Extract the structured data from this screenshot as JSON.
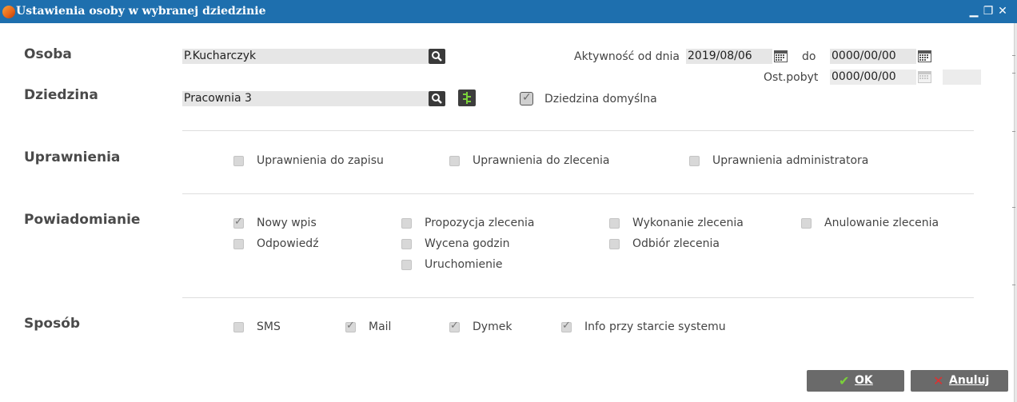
{
  "window": {
    "title": "Ustawienia osoby w wybranej dziedzinie",
    "controls": {
      "minimize": "▁",
      "restore": "❐",
      "close": "✕"
    }
  },
  "person": {
    "label": "Osoba",
    "value": "P.Kucharczyk",
    "search_icon": "magnifier-icon"
  },
  "domain": {
    "label": "Dziedzina",
    "value": "Pracownia 3",
    "search_icon": "magnifier-icon",
    "extra_icon": "tree-icon",
    "default_label": "Dziedzina domyślna",
    "default_checked": true
  },
  "activity": {
    "from_label": "Aktywność od dnia",
    "from_value": "2019/08/06",
    "to_label": "do",
    "to_value": "0000/00/00",
    "last_stay_label": "Ost.pobyt",
    "last_stay_value": "0000/00/00",
    "last_stay_extra": ""
  },
  "permissions": {
    "label": "Uprawnienia",
    "items": [
      {
        "label": "Uprawnienia do zapisu",
        "checked": false
      },
      {
        "label": "Uprawnienia do zlecenia",
        "checked": false
      },
      {
        "label": "Uprawnienia administratora",
        "checked": false
      }
    ]
  },
  "notifications": {
    "label": "Powiadomianie",
    "items": [
      {
        "label": "Nowy wpis",
        "checked": true
      },
      {
        "label": "Propozycja zlecenia",
        "checked": false
      },
      {
        "label": "Wykonanie zlecenia",
        "checked": false
      },
      {
        "label": "Anulowanie zlecenia",
        "checked": false
      },
      {
        "label": "Odpowiedź",
        "checked": false
      },
      {
        "label": "Wycena godzin",
        "checked": false
      },
      {
        "label": "Odbiór zlecenia",
        "checked": false
      },
      {
        "label": "Uruchomienie",
        "checked": false
      }
    ]
  },
  "method": {
    "label": "Sposób",
    "items": [
      {
        "label": "SMS",
        "checked": false
      },
      {
        "label": "Mail",
        "checked": true
      },
      {
        "label": "Dymek",
        "checked": true
      },
      {
        "label": "Info przy starcie systemu",
        "checked": true
      }
    ]
  },
  "buttons": {
    "ok_label": "OK",
    "ok_icon": "checkmark-icon",
    "cancel_label": "Anuluj",
    "cancel_icon": "x-icon"
  },
  "colors": {
    "titlebar": "#1e6fae",
    "button": "#6a6a6a",
    "ok_check": "#7bd13a",
    "cancel_x": "#e03030"
  }
}
